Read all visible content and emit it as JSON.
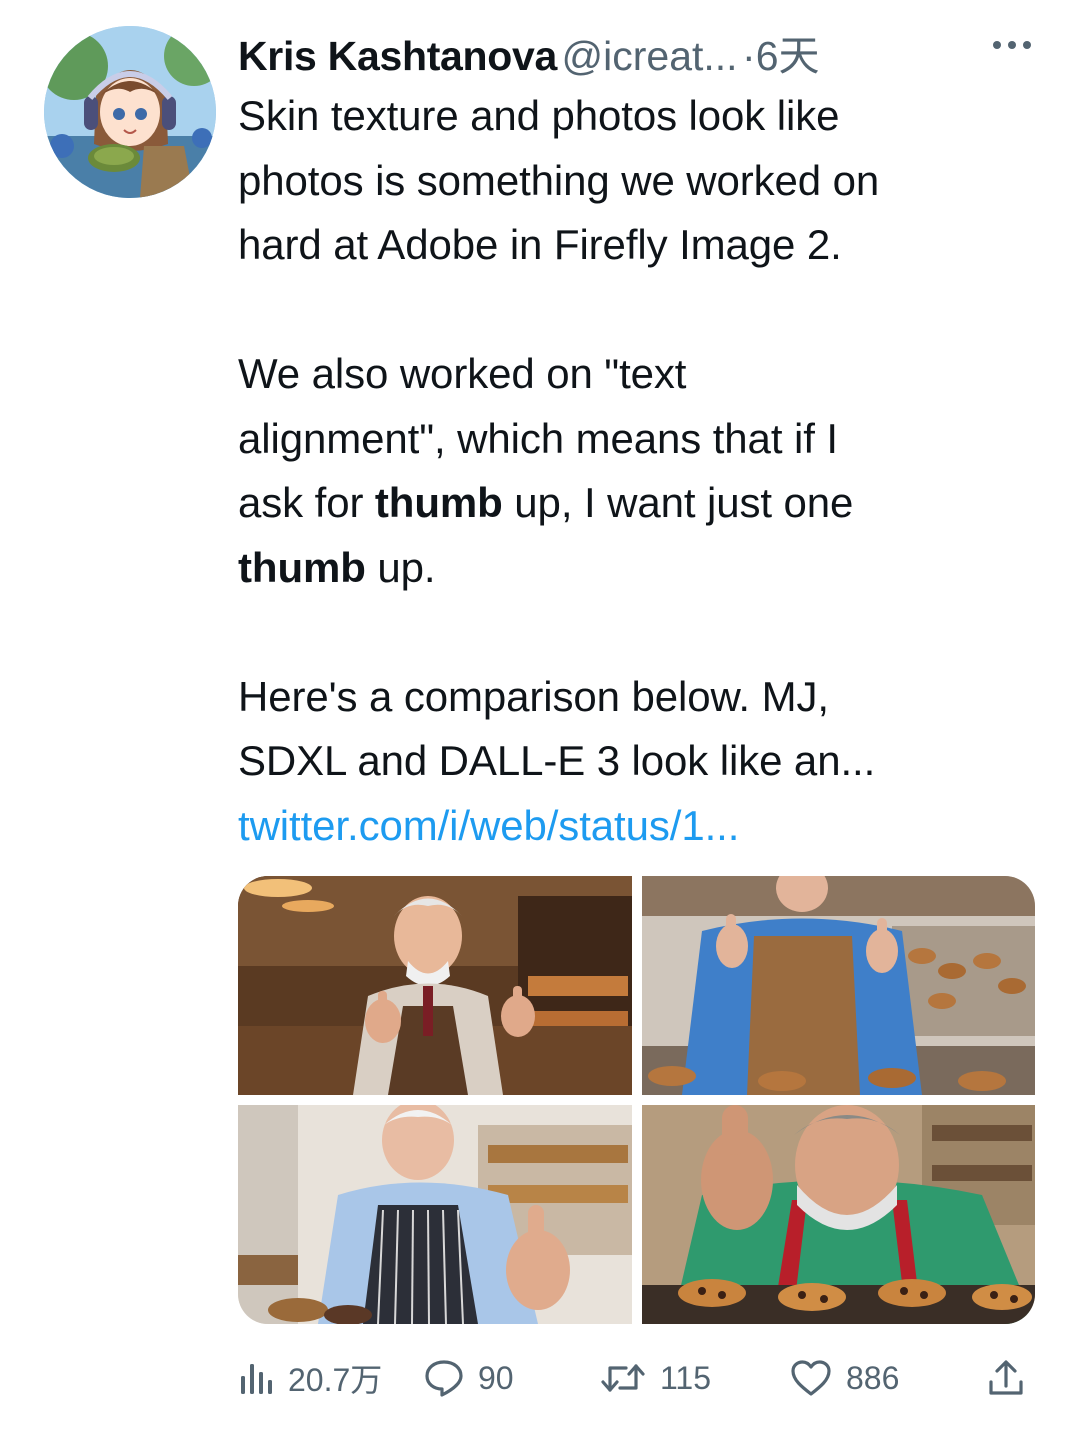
{
  "author": {
    "name": "Kris Kashtanova",
    "handle": "@icreat...",
    "separator": "·",
    "time": "6天"
  },
  "icons": {
    "more": "more-icon",
    "views": "views-icon",
    "reply": "reply-icon",
    "retweet": "retweet-icon",
    "like": "heart-icon",
    "share": "share-icon"
  },
  "tweet": {
    "p1": {
      "l1": "Skin texture and photos look like",
      "l2": "photos is something we worked on",
      "l3": "hard at Adobe in Firefly Image 2."
    },
    "p2": {
      "l1": "We also worked on \"text",
      "l2": "alignment\", which means that if I",
      "l3_a": "ask for ",
      "l3_b": "thumb",
      "l3_c": " up, I want just one",
      "l4_b": "thumb",
      "l4_c": " up."
    },
    "p3": {
      "l1": "Here's a comparison below. MJ,",
      "l2": "SDXL and DALL-E 3 look like an..."
    },
    "link": "twitter.com/i/web/status/1..."
  },
  "media": {
    "count": 4,
    "photos": [
      "baker-thumbs-up-photo",
      "baker-thumbs-up-photo",
      "baker-thumbs-up-photo",
      "baker-thumbs-up-photo"
    ]
  },
  "stats": {
    "views": "20.7万",
    "replies": "90",
    "retweets": "115",
    "likes": "886"
  },
  "colors": {
    "text": "#0f1419",
    "secondary": "#536471",
    "link": "#1d9bf0"
  }
}
